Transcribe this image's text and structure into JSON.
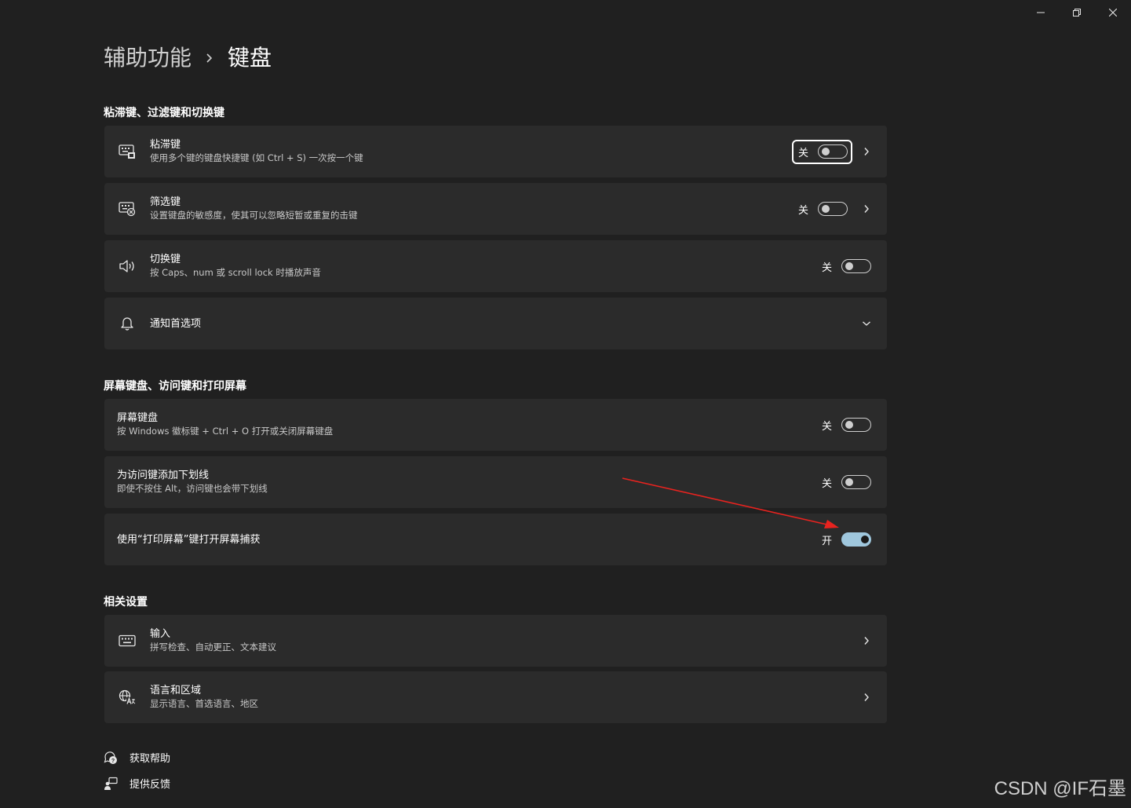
{
  "window": {
    "minimize_label": "—",
    "restore_label": "❐",
    "close_label": "✕"
  },
  "breadcrumb": {
    "parent": "辅助功能",
    "current": "键盘"
  },
  "sections": {
    "sticky": {
      "title": "粘滞键、过滤键和切换键",
      "items": [
        {
          "title": "粘滞键",
          "subtitle": "使用多个键的键盘快捷键 (如 Ctrl + S) 一次按一个键",
          "state_label": "关",
          "on": false
        },
        {
          "title": "筛选键",
          "subtitle": "设置键盘的敏感度，使其可以忽略短暂或重复的击键",
          "state_label": "关",
          "on": false
        },
        {
          "title": "切换键",
          "subtitle": "按 Caps、num 或 scroll lock 时播放声音",
          "state_label": "关",
          "on": false
        },
        {
          "title": "通知首选项"
        }
      ]
    },
    "onscreen": {
      "title": "屏幕键盘、访问键和打印屏幕",
      "items": [
        {
          "title": "屏幕键盘",
          "subtitle": "按 Windows 徽标键 + Ctrl + O 打开或关闭屏幕键盘",
          "state_label": "关",
          "on": false
        },
        {
          "title": "为访问键添加下划线",
          "subtitle": "即使不按住 Alt，访问键也会带下划线",
          "state_label": "关",
          "on": false
        },
        {
          "title": "使用“打印屏幕”键打开屏幕捕获",
          "state_label": "开",
          "on": true
        }
      ]
    },
    "related": {
      "title": "相关设置",
      "items": [
        {
          "title": "输入",
          "subtitle": "拼写检查、自动更正、文本建议"
        },
        {
          "title": "语言和区域",
          "subtitle": "显示语言、首选语言、地区"
        }
      ]
    }
  },
  "footer": {
    "help": "获取帮助",
    "feedback": "提供反馈"
  },
  "watermark": "CSDN @IF石墨",
  "colors": {
    "background": "#202020",
    "card": "#2b2b2b",
    "toggle_on": "#9fc7dd",
    "annotation_arrow": "#e8231f"
  }
}
